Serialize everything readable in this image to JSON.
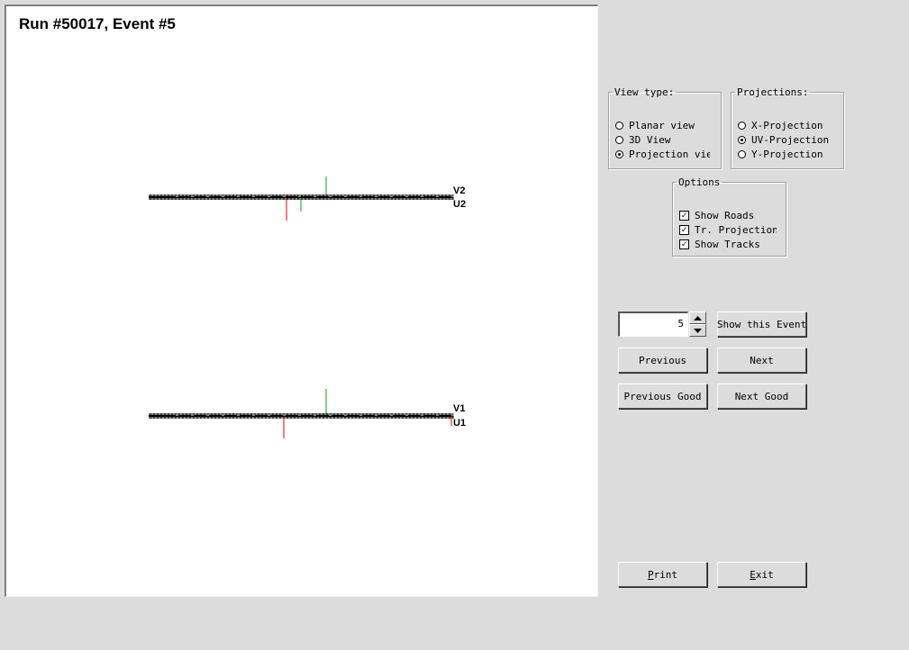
{
  "canvas": {
    "title": "Run #50017, Event #5",
    "detector_labels": [
      "V2",
      "U2",
      "V1",
      "U1"
    ]
  },
  "view_type": {
    "legend": "View type:",
    "options": [
      "Planar view",
      "3D View",
      "Projection view"
    ],
    "selected": "Projection view"
  },
  "projections": {
    "legend": "Projections:",
    "options": [
      "X-Projection",
      "UV-Projection",
      "Y-Projection"
    ],
    "selected": "UV-Projection"
  },
  "options": {
    "legend": "Options",
    "items": [
      {
        "label": "Show Roads",
        "checked": true
      },
      {
        "label": "Tr. Projections",
        "checked": true
      },
      {
        "label": "Show Tracks",
        "checked": true
      }
    ]
  },
  "event_nav": {
    "event_number": "5",
    "show_event_label": "Show this Event",
    "previous_label": "Previous",
    "next_label": "Next",
    "previous_good_label": "Previous Good",
    "next_good_label": "Next Good"
  },
  "footer": {
    "print_label": "Print",
    "print_mnemonic": "P",
    "print_rest": "rint",
    "exit_label": "Exit",
    "exit_mnemonic": "E",
    "exit_rest": "xit"
  },
  "colors": {
    "v_hit": "#00aa00",
    "u_hit": "#dd0000",
    "background": "#dcdcdc"
  }
}
